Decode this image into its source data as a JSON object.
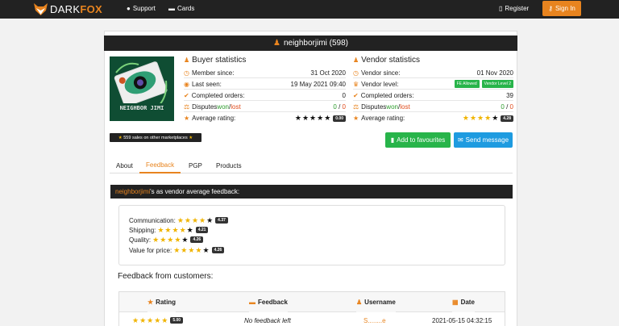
{
  "nav": {
    "brand_dark": "DARK",
    "brand_fox": "FOX",
    "support": "Support",
    "cards": "Cards",
    "register": "Register",
    "sign_in": "Sign In"
  },
  "profile": {
    "header": "neighborjimi (598)",
    "avatar_text": "NEIGHBOR JIMI",
    "buyer": {
      "title": "Buyer statistics",
      "member_since_label": "Member since:",
      "member_since": "31 Oct 2020",
      "last_seen_label": "Last seen:",
      "last_seen": "19 May 2021 09:40",
      "completed_label": "Completed orders:",
      "completed": "0",
      "disputes_label": "Disputes ",
      "won_word": "won",
      "slash": "/",
      "lost_word": "lost",
      "disputes_won": "0",
      "disputes_lost": "0",
      "rating_label": "Average rating:",
      "rating_stars": "★★★★★",
      "rating_value": "0.00"
    },
    "vendor": {
      "title": "Vendor statistics",
      "vendor_since_label": "Vendor since:",
      "vendor_since": "01 Nov 2020",
      "level_label": "Vendor level:",
      "fe_tag": "FE Allowed",
      "level_tag": "Vendor Level 2",
      "completed_label": "Completed orders:",
      "completed": "39",
      "disputes_label": "Disputes ",
      "won_word": "won",
      "slash": "/",
      "lost_word": "lost",
      "disputes_won": "0",
      "disputes_lost": "0",
      "rating_label": "Average rating:",
      "rating_stars": "★★★★",
      "rating_half": "★",
      "rating_value": "4.28"
    },
    "sales_badge": "559 sales on other marketplaces",
    "add_fav": "Add to favourites",
    "send_msg": "Send message"
  },
  "tabs": [
    "About",
    "Feedback",
    "PGP",
    "Products"
  ],
  "feedback": {
    "vendor_name": "neighborjimi",
    "header_suffix": "'s as vendor average feedback:",
    "averages": [
      {
        "label": "Communication:",
        "stars": "★★★★",
        "half": "★",
        "value": "4.37"
      },
      {
        "label": "Shipping:",
        "stars": "★★★★",
        "half": "★",
        "value": "4.21"
      },
      {
        "label": "Quality:",
        "stars": "★★★★",
        "half": "★",
        "value": "4.26"
      },
      {
        "label": "Value for price:",
        "stars": "★★★★",
        "half": "★",
        "value": "4.26"
      }
    ],
    "section_title": "Feedback from customers:",
    "columns": {
      "rating": "Rating",
      "feedback": "Feedback",
      "username": "Username",
      "date": "Date"
    },
    "rows": [
      {
        "stars": "★★★★★",
        "value": "5.00",
        "feedback": "No feedback left",
        "username": "S........e",
        "date": "2021-05-15 04:32:15"
      }
    ]
  },
  "colors": {
    "accent": "#e8841f",
    "success": "#28b44a",
    "info": "#1e9be0",
    "dark": "#222222"
  }
}
